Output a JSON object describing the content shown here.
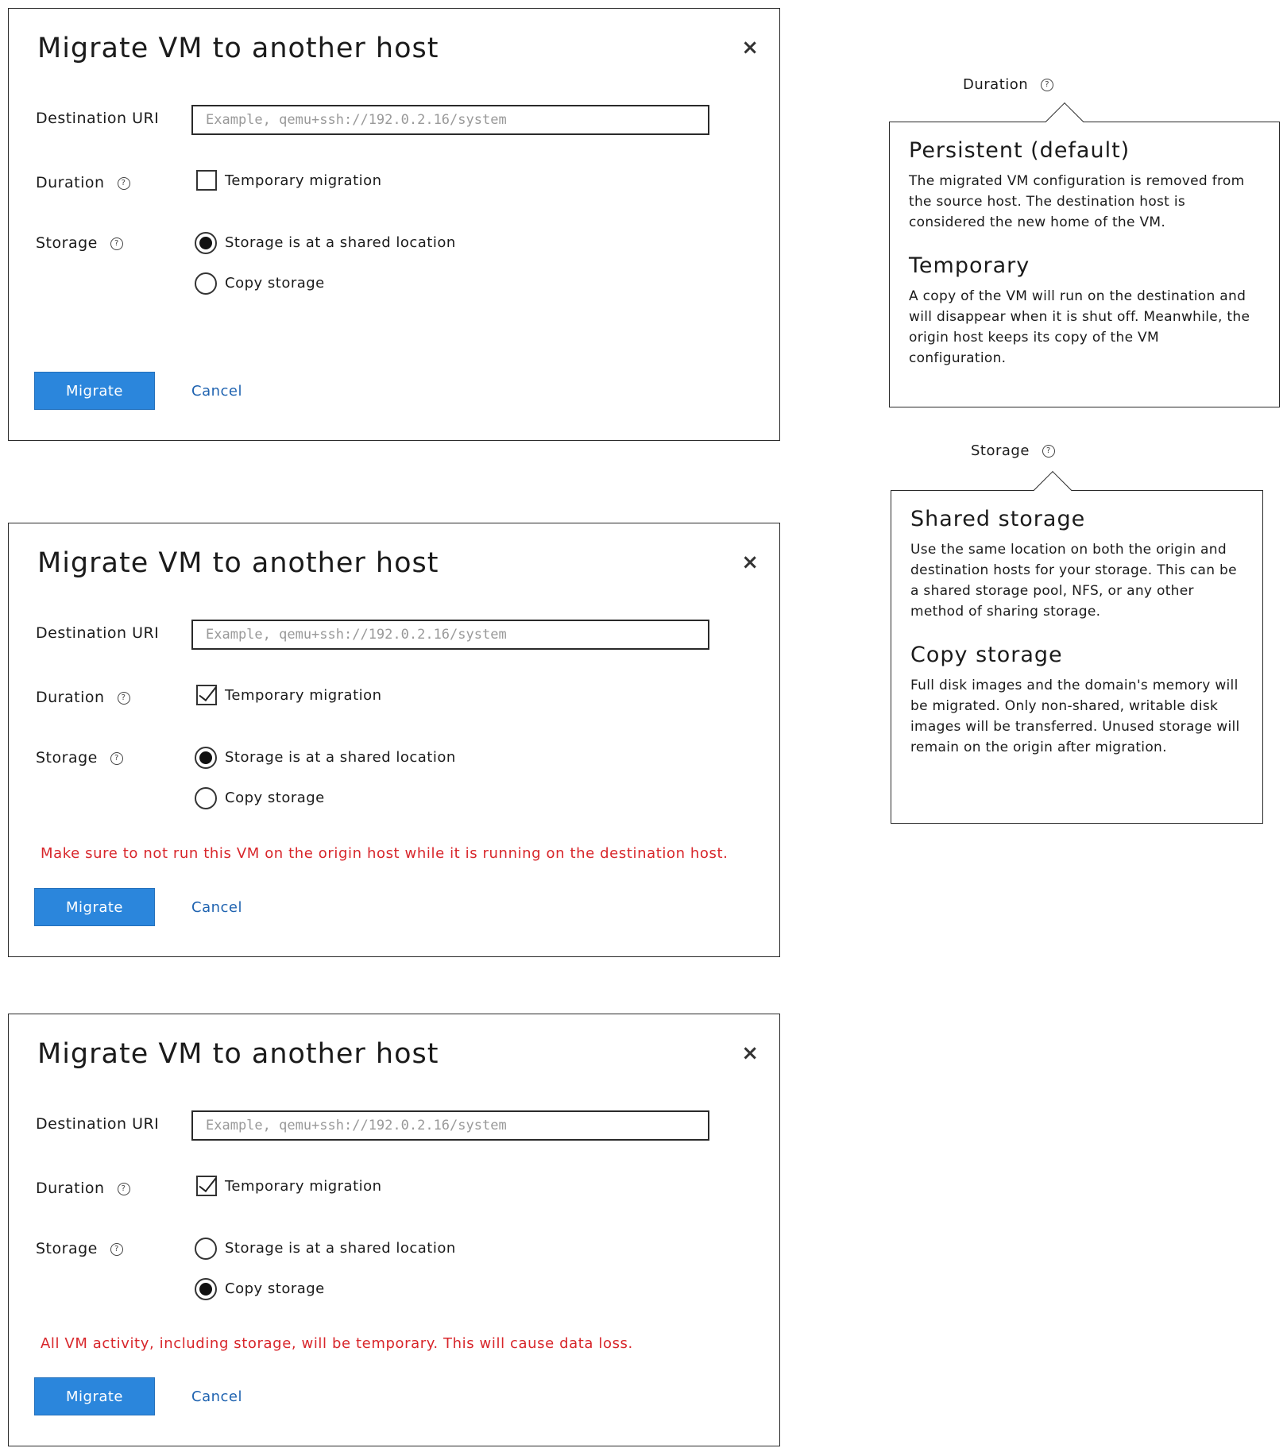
{
  "dialog": {
    "title": "Migrate VM to another host",
    "close_glyph": "×",
    "destination_label": "Destination URI",
    "destination_placeholder": "Example, qemu+ssh://192.0.2.16/system",
    "duration_label": "Duration",
    "help_glyph": "?",
    "temporary_label": "Temporary migration",
    "storage_label": "Storage",
    "storage_shared_label": "Storage is at a shared location",
    "storage_copy_label": "Copy storage",
    "migrate_label": "Migrate",
    "cancel_label": "Cancel"
  },
  "states": [
    {
      "temporary_checked": false,
      "storage_selected": "shared",
      "warning": ""
    },
    {
      "temporary_checked": true,
      "storage_selected": "shared",
      "warning": "Make sure to not run this VM on the origin host while it is running on the destination host."
    },
    {
      "temporary_checked": true,
      "storage_selected": "copy",
      "warning": "All VM activity, including storage, will be temporary. This will cause data loss."
    }
  ],
  "duration_popover": {
    "anchor_label": "Duration",
    "sections": [
      {
        "heading": "Persistent (default)",
        "text": "The migrated VM configuration is removed from the source host. The destination host is considered the new home of the VM."
      },
      {
        "heading": "Temporary",
        "text": "A copy of the VM will run on the destination and will disappear when it is shut off. Meanwhile, the origin host keeps its copy of the VM configuration."
      }
    ]
  },
  "storage_popover": {
    "anchor_label": "Storage",
    "sections": [
      {
        "heading": "Shared storage",
        "text": "Use the same location on both the origin and destination hosts for your storage. This can be a shared storage pool, NFS, or any other method of sharing storage."
      },
      {
        "heading": "Copy storage",
        "text": "Full disk images and the domain's memory will be migrated. Only non-shared, writable disk images will be transferred. Unused storage will remain on the origin after migration."
      }
    ]
  },
  "colors": {
    "primary": "#2b86dc",
    "link": "#1f63b0",
    "danger": "#d8262b",
    "border": "#2a2a2a"
  }
}
